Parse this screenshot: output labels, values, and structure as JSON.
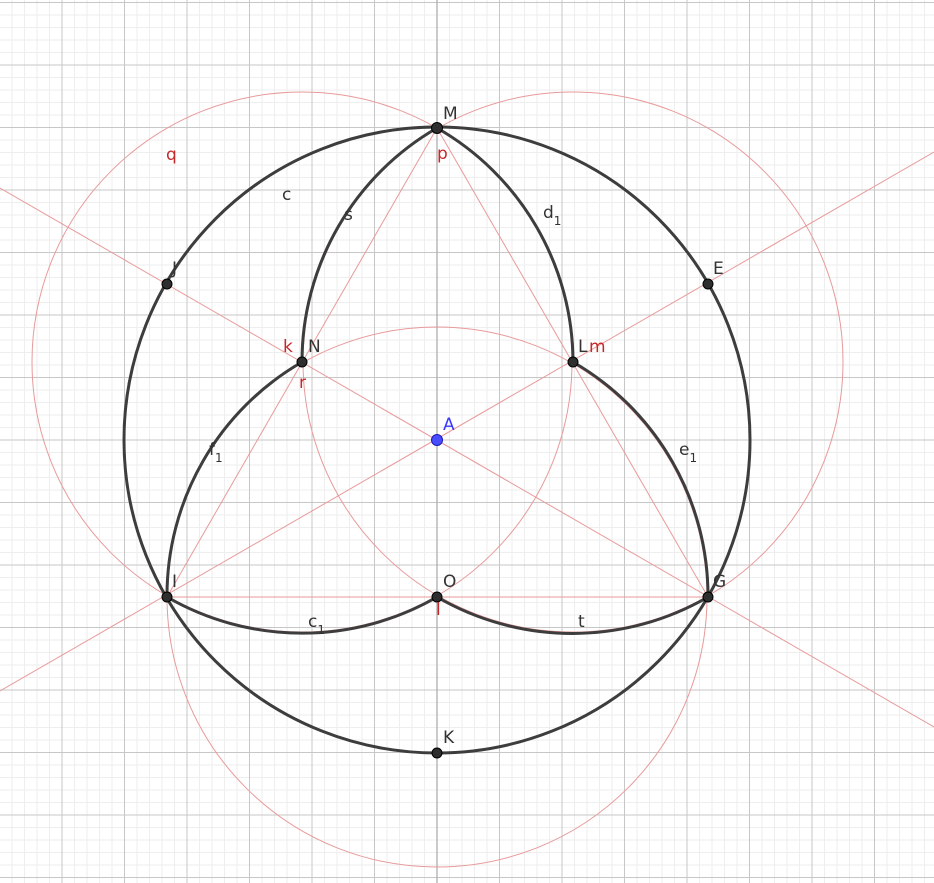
{
  "points": {
    "A": "A",
    "M": "M",
    "E": "E",
    "J": "J",
    "N": "N",
    "L": "L",
    "I": "I",
    "O": "O",
    "G": "G",
    "K": "K"
  },
  "objects": {
    "c": "c",
    "s": "s",
    "d": "d",
    "d_sub": "1",
    "e": "e",
    "e_sub": "1",
    "f": "f",
    "f_sub": "1",
    "c1": "c",
    "c1_sub": "1",
    "t": "t",
    "q": "q",
    "p": "p",
    "k": "k",
    "r": "r",
    "m": "m",
    "l": "l"
  },
  "colors": {
    "background": "#ffffff",
    "grid_minor": "#eeeeee",
    "grid_major": "#c7c7c7",
    "axis": "#a8a8a8",
    "auxiliary": "#e89a9a",
    "arc": "#3d3d3d",
    "point": "#2e2e2e",
    "center_point": "#4a4cff",
    "label_red": "#c62828"
  }
}
